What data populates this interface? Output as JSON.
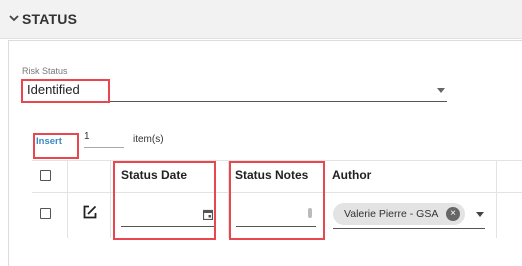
{
  "section": {
    "title": "STATUS",
    "toggle_icon": "chevron-down-icon"
  },
  "risk_status": {
    "label": "Risk Status",
    "value": "Identified"
  },
  "toolbar": {
    "insert_label": "Insert",
    "insert_qty": "1",
    "items_label": "item(s)"
  },
  "grid": {
    "columns": [
      {
        "key": "select",
        "label": ""
      },
      {
        "key": "edit",
        "label": ""
      },
      {
        "key": "status_date",
        "label": "Status Date"
      },
      {
        "key": "status_notes",
        "label": "Status Notes"
      },
      {
        "key": "author",
        "label": "Author"
      }
    ],
    "row": {
      "status_date": "",
      "status_notes": "",
      "author": "Valerie Pierre - GSA"
    }
  },
  "colors": {
    "highlight": "#e8474f",
    "link": "#3a8ac6",
    "chip_bg": "#e3e3e3"
  }
}
